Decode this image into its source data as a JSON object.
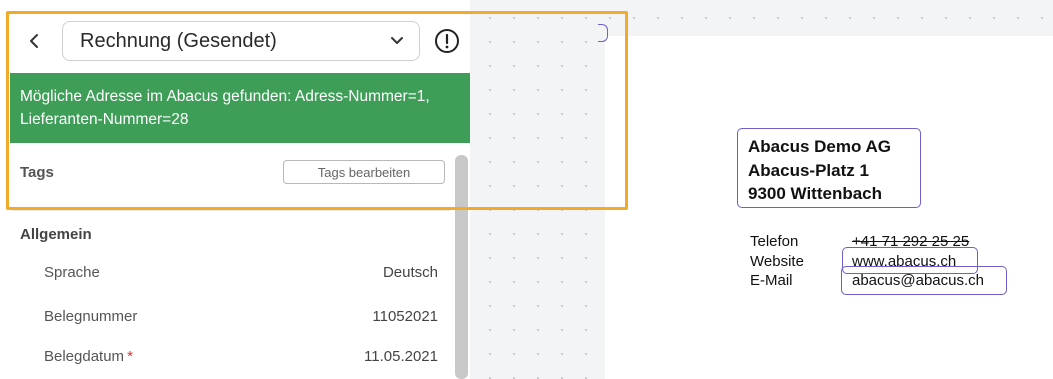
{
  "left_panel": {
    "document_type": "Rechnung (Gesendet)",
    "banner": {
      "line1": "Mögliche Adresse im Abacus gefunden: Adress-Nummer=1,",
      "line2": "Lieferanten-Nummer=28",
      "color": "#3e9e58"
    },
    "tags": {
      "label": "Tags",
      "edit_button": "Tags bearbeiten"
    },
    "section": {
      "title": "Allgemein",
      "fields": [
        {
          "label": "Sprache",
          "value": "Deutsch",
          "required": false
        },
        {
          "label": "Belegnummer",
          "value": "11052021",
          "required": false
        },
        {
          "label": "Belegdatum",
          "value": "11.05.2021",
          "required": true,
          "required_mark": "*"
        }
      ]
    },
    "icons": {
      "back": "chevron-left-icon",
      "select": "chevron-down-icon",
      "alert": "exclamation-circle-icon"
    }
  },
  "document": {
    "address": [
      "Abacus Demo AG",
      "Abacus-Platz 1",
      "9300 Wittenbach"
    ],
    "contacts": [
      {
        "label": "Telefon",
        "value": "+41 71 292 25 25"
      },
      {
        "label": "Website",
        "value": "www.abacus.ch"
      },
      {
        "label": "E-Mail",
        "value": "abacus@abacus.ch"
      }
    ]
  },
  "colors": {
    "highlight": "#f1aa2a",
    "detection_box": "#6f5ecc",
    "required": "#e03030"
  }
}
